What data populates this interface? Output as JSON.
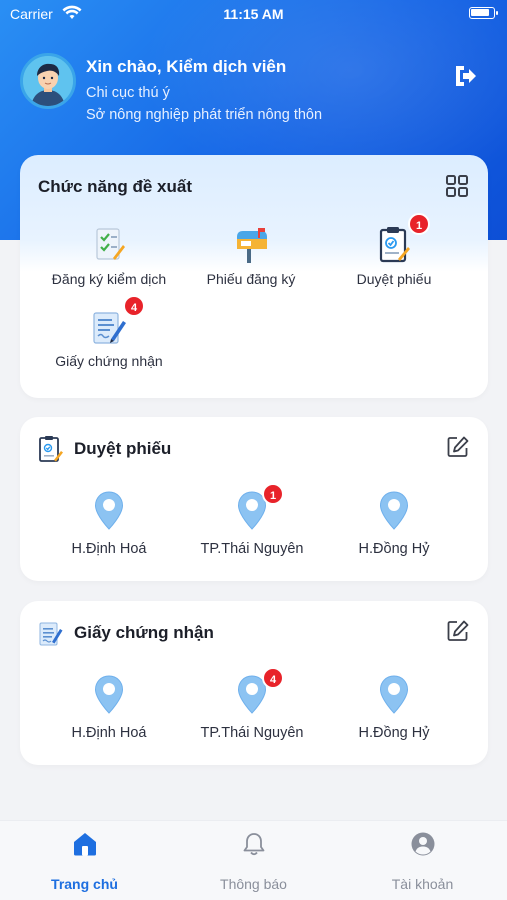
{
  "status_bar": {
    "carrier": "Carrier",
    "time": "11:15 AM"
  },
  "header": {
    "greeting": "Xin chào, Kiểm dịch viên",
    "department": "Chi cục thú ý",
    "organization": "Sở nông nghiệp phát triển nông thôn"
  },
  "suggested": {
    "title": "Chức năng đề xuất",
    "items": [
      {
        "label": "Đăng ký kiểm dịch",
        "icon": "register-quarantine-icon"
      },
      {
        "label": "Phiếu đăng ký",
        "icon": "mailbox-icon"
      },
      {
        "label": "Duyệt phiếu",
        "icon": "review-clipboard-icon",
        "badge": "1"
      },
      {
        "label": "Giấy chứng nhận",
        "icon": "certificate-icon",
        "badge": "4"
      }
    ]
  },
  "review": {
    "title": "Duyệt phiếu",
    "locations": [
      {
        "label": "H.Định Hoá"
      },
      {
        "label": "TP.Thái Nguyên",
        "badge": "1"
      },
      {
        "label": "H.Đồng Hỷ"
      }
    ]
  },
  "certificates": {
    "title": "Giấy chứng nhận",
    "locations": [
      {
        "label": "H.Định Hoá"
      },
      {
        "label": "TP.Thái Nguyên",
        "badge": "4"
      },
      {
        "label": "H.Đồng Hỷ"
      }
    ]
  },
  "tabbar": {
    "tabs": [
      {
        "label": "Trang chủ",
        "icon": "home-icon",
        "active": true
      },
      {
        "label": "Thông báo",
        "icon": "bell-icon"
      },
      {
        "label": "Tài khoản",
        "icon": "user-icon"
      }
    ]
  },
  "colors": {
    "accent": "#1e6fe0",
    "badge": "#e8232a",
    "pin": "#8cc3f2"
  }
}
